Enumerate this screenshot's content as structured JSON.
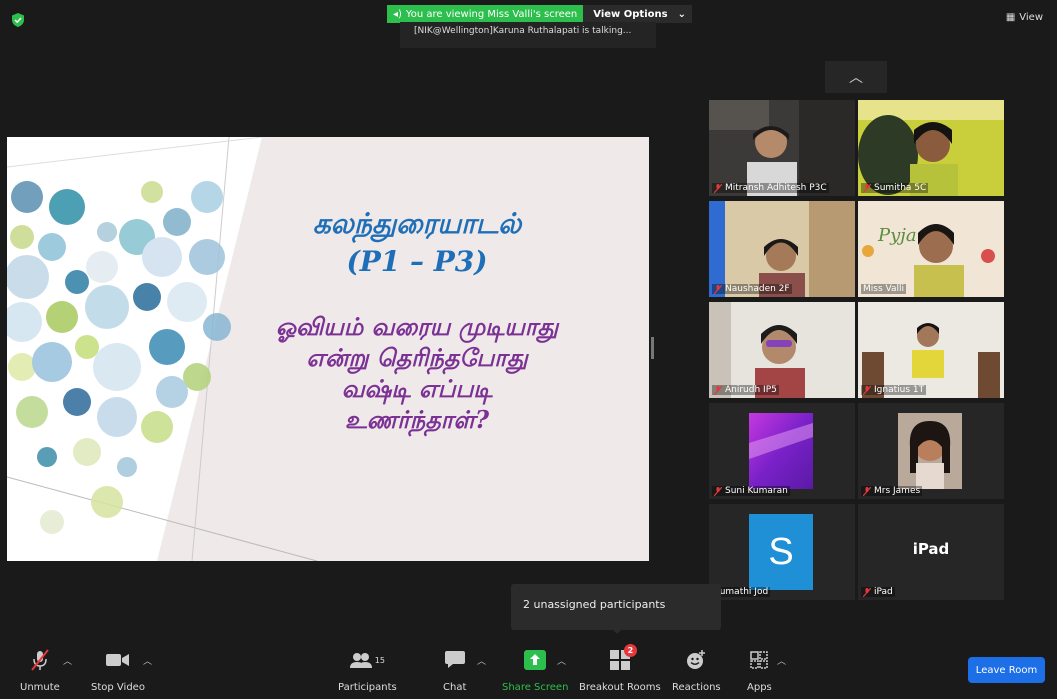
{
  "banner": {
    "viewing": "You are viewing Miss Valli's screen",
    "view_options": "View Options",
    "talking": "[NIK@Wellington]Karuna Ruthalapati is talking..."
  },
  "view_button": "View",
  "slide": {
    "title": "கலந்துரையாடல்",
    "subtitle": "(P1 – P3)",
    "question_lines": [
      "ஓவியம் வரைய முடியாது",
      "என்று தெரிந்தபோது",
      "வஷ்டி எப்படி",
      "உணர்ந்தாள்?"
    ]
  },
  "participants": [
    {
      "name": "Mitransh Adhitesh P3C",
      "muted": true
    },
    {
      "name": "Sumitha 5C",
      "muted": true
    },
    {
      "name": "Naushaden 2F",
      "muted": true
    },
    {
      "name": "Miss Valli",
      "muted": false
    },
    {
      "name": "Anirudh IP5",
      "muted": true
    },
    {
      "name": "Ignatius 1T",
      "muted": true
    },
    {
      "name": "Suni Kumaran",
      "muted": true
    },
    {
      "name": "Mrs James",
      "muted": true
    },
    {
      "name": "Sumathi Jod",
      "muted": false,
      "avatar_letter": "S"
    },
    {
      "name": "iPad",
      "muted": true,
      "label": "iPad"
    }
  ],
  "popup": "2 unassigned participants",
  "toolbar": {
    "unmute": "Unmute",
    "stop_video": "Stop Video",
    "participants": "Participants",
    "participants_count": "15",
    "chat": "Chat",
    "share_screen": "Share Screen",
    "breakout_rooms": "Breakout Rooms",
    "breakout_badge": "2",
    "reactions": "Reactions",
    "apps": "Apps",
    "leave_room": "Leave Room"
  },
  "colors": {
    "share_green": "#2dbf4d",
    "leave_blue": "#1c6fe6",
    "muted_red": "#e5383b",
    "slide_blue": "#1f6fb8",
    "slide_purple": "#7b3294"
  }
}
